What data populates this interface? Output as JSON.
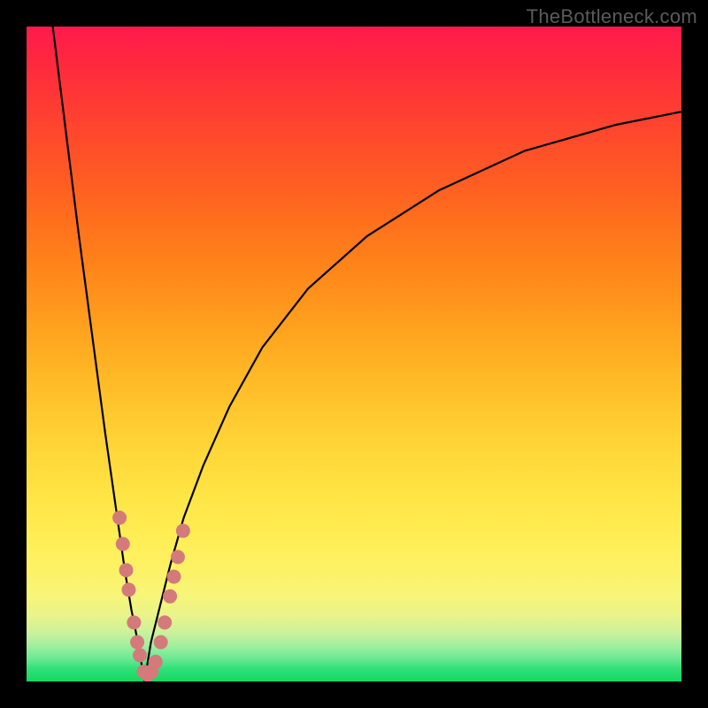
{
  "watermark": "TheBottleneck.com",
  "colors": {
    "frame": "#000000",
    "curve": "#000000",
    "dot": "#d47a7a",
    "gradient_top": "#ff1a4d",
    "gradient_bottom": "#13d95e"
  },
  "chart_data": {
    "type": "line",
    "title": "",
    "xlabel": "",
    "ylabel": "",
    "xlim": [
      0,
      100
    ],
    "ylim": [
      0,
      100
    ],
    "notch_x": 18,
    "series": [
      {
        "name": "left-branch",
        "x": [
          4,
          6,
          8,
          10,
          12,
          14,
          15,
          16,
          17,
          17.5,
          18
        ],
        "y": [
          100,
          84,
          68,
          53,
          38,
          24,
          17,
          11,
          6,
          3,
          0
        ]
      },
      {
        "name": "right-branch",
        "x": [
          18,
          18.5,
          19,
          20,
          21,
          22,
          24,
          27,
          31,
          36,
          43,
          52,
          63,
          76,
          90,
          100
        ],
        "y": [
          0,
          3,
          6,
          10,
          14,
          18,
          25,
          33,
          42,
          51,
          60,
          68,
          75,
          81,
          85,
          87
        ]
      }
    ],
    "scatter": {
      "name": "sample-points",
      "points": [
        {
          "x": 14.2,
          "y": 25
        },
        {
          "x": 14.7,
          "y": 21
        },
        {
          "x": 15.2,
          "y": 17
        },
        {
          "x": 15.6,
          "y": 14
        },
        {
          "x": 16.4,
          "y": 9
        },
        {
          "x": 16.9,
          "y": 6
        },
        {
          "x": 17.3,
          "y": 4
        },
        {
          "x": 17.9,
          "y": 1.5
        },
        {
          "x": 18.5,
          "y": 1
        },
        {
          "x": 19.1,
          "y": 1.5
        },
        {
          "x": 19.7,
          "y": 3
        },
        {
          "x": 20.5,
          "y": 6
        },
        {
          "x": 21.1,
          "y": 9
        },
        {
          "x": 21.9,
          "y": 13
        },
        {
          "x": 22.5,
          "y": 16
        },
        {
          "x": 23.1,
          "y": 19
        },
        {
          "x": 23.9,
          "y": 23
        }
      ]
    }
  }
}
